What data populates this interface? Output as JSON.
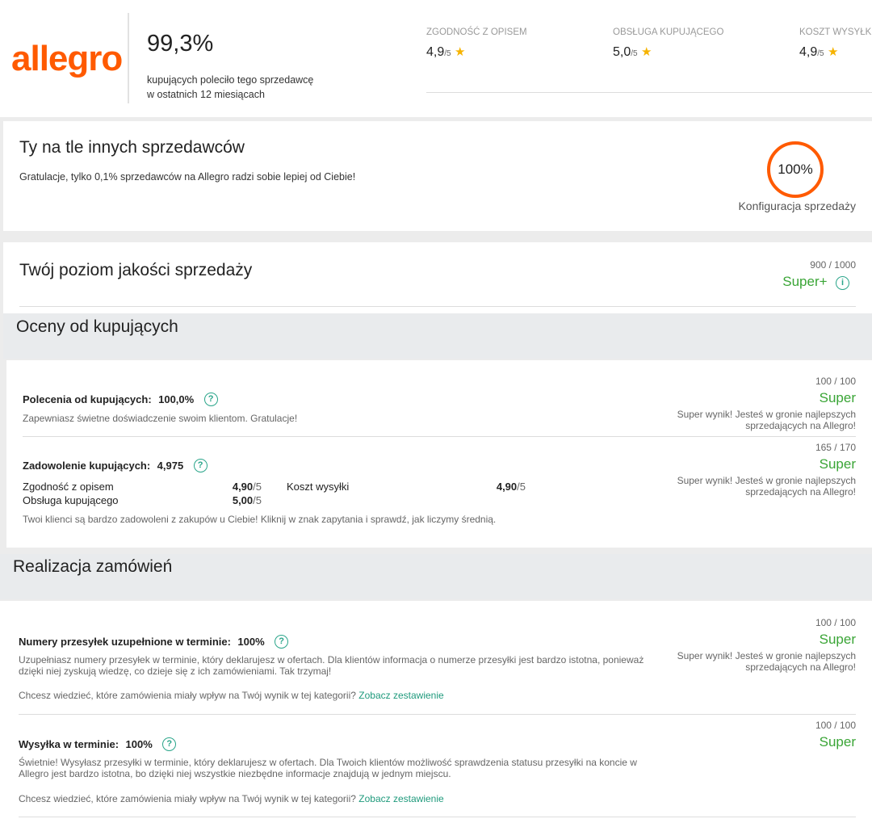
{
  "header": {
    "logo": "allegro",
    "recommend_percent": "99,3%",
    "recommend_text_1": "kupujących poleciło tego sprzedawcę",
    "recommend_text_2": "w ostatnich 12 miesiącach",
    "ratings": [
      {
        "label": "ZGODNOŚĆ Z OPISEM",
        "value": "4,9",
        "scale": "/5"
      },
      {
        "label": "OBSŁUGA KUPUJĄCEGO",
        "value": "5,0",
        "scale": "/5"
      },
      {
        "label": "KOSZT WYSYŁKI",
        "value": "4,9",
        "scale": "/5"
      }
    ]
  },
  "compare": {
    "title": "Ty na tle innych sprzedawców",
    "text": "Gratulacje, tylko 0,1% sprzedawców na Allegro radzi sobie lepiej od Ciebie!",
    "circle_value": "100%",
    "circle_fraction": 1.0,
    "circle_label": "Konfiguracja sprzedaży"
  },
  "quality": {
    "title": "Twój poziom jakości sprzedaży",
    "score": "900 / 1000",
    "level": "Super+",
    "info_icon": "info-icon"
  },
  "ratings_section": {
    "title": "Oceny od kupujących",
    "recommendations": {
      "label": "Polecenia od kupujących:",
      "value": "100,0%",
      "desc": "Zapewniasz świetne doświadczenie swoim klientom. Gratulacje!",
      "score": "100 / 100",
      "level": "Super",
      "level_desc": "Super wynik! Jesteś w gronie najlepszych sprzedających na Allegro!"
    },
    "satisfaction": {
      "label": "Zadowolenie kupujących:",
      "value": "4,975",
      "items": [
        {
          "label": "Zgodność z opisem",
          "value": "4,90",
          "scale": "/5"
        },
        {
          "label": "Koszt wysyłki",
          "value": "4,90",
          "scale": "/5"
        },
        {
          "label": "Obsługa kupującego",
          "value": "5,00",
          "scale": "/5"
        }
      ],
      "desc": "Twoi klienci są bardzo zadowoleni z zakupów u Ciebie! Kliknij w znak zapytania i sprawdź, jak liczymy średnią.",
      "score": "165 / 170",
      "level": "Super",
      "level_desc": "Super wynik! Jesteś w gronie najlepszych sprzedających na Allegro!"
    }
  },
  "orders_section": {
    "title": "Realizacja zamówień",
    "tracking": {
      "label": "Numery przesyłek uzupełnione w terminie:",
      "value": "100%",
      "desc": "Uzupełniasz numery przesyłek w terminie, który deklarujesz w ofertach. Dla klientów informacja o numerze przesyłki jest bardzo istotna, ponieważ dzięki niej zyskują wiedzę, co dzieje się z ich zamówieniami. Tak trzymaj!",
      "question": "Chcesz wiedzieć, które zamówienia miały wpływ na Twój wynik w tej kategorii?",
      "link": "Zobacz zestawienie",
      "score": "100 / 100",
      "level": "Super",
      "level_desc": "Super wynik! Jesteś w gronie najlepszych sprzedających na Allegro!"
    },
    "shipping": {
      "label": "Wysyłka w terminie:",
      "value": "100%",
      "desc": "Świetnie! Wysyłasz przesyłki w terminie, który deklarujesz w ofertach. Dla Twoich klientów możliwość sprawdzenia statusu przesyłki na koncie w Allegro jest bardzo istotna, bo dzięki niej wszystkie niezbędne informacje znajdują w jednym miejscu.",
      "question": "Chcesz wiedzieć, które zamówienia miały wpływ na Twój wynik w tej kategorii?",
      "link": "Zobacz zestawienie",
      "score": "100 / 100",
      "level": "Super"
    }
  },
  "colors": {
    "brand": "#ff5a00",
    "accent_green": "#3aa536",
    "teal": "#2aa58a",
    "star": "#f6b300"
  }
}
